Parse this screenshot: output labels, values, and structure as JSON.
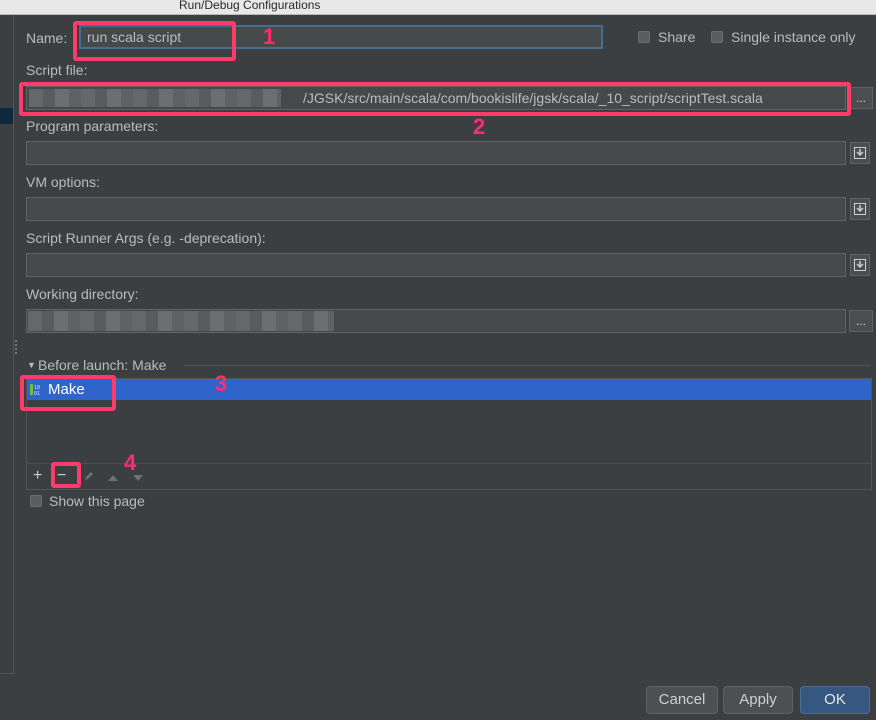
{
  "window": {
    "title": "Run/Debug Configurations"
  },
  "name_row": {
    "label": "Name:",
    "value": "run scala script",
    "share_label": "Share",
    "single_instance_label": "Single instance only"
  },
  "script_file": {
    "label": "Script file:",
    "value": "/JGSK/src/main/scala/com/bookislife/jgsk/scala/_10_script/scriptTest.scala",
    "browse_label": "..."
  },
  "program_parameters": {
    "label": "Program parameters:",
    "value": ""
  },
  "vm_options": {
    "label": "VM options:",
    "value": ""
  },
  "script_runner_args": {
    "label": "Script Runner Args (e.g. -deprecation):",
    "value": ""
  },
  "working_directory": {
    "label": "Working directory:",
    "value": "",
    "browse_label": "..."
  },
  "before_launch": {
    "header": "Before launch: Make",
    "items": [
      {
        "label": "Make",
        "icon": "make-icon",
        "selected": true
      }
    ],
    "toolbar": {
      "add": "+",
      "remove": "−"
    }
  },
  "show_this_page": {
    "label": "Show this page"
  },
  "annotations": [
    "1",
    "2",
    "3",
    "4"
  ],
  "buttons": {
    "cancel": "Cancel",
    "apply": "Apply",
    "ok": "OK"
  },
  "colors": {
    "background": "#3c3f41",
    "field": "#45494a",
    "selection": "#2f65ca",
    "annotation": "#ff3b6b",
    "primary_button": "#365880"
  }
}
